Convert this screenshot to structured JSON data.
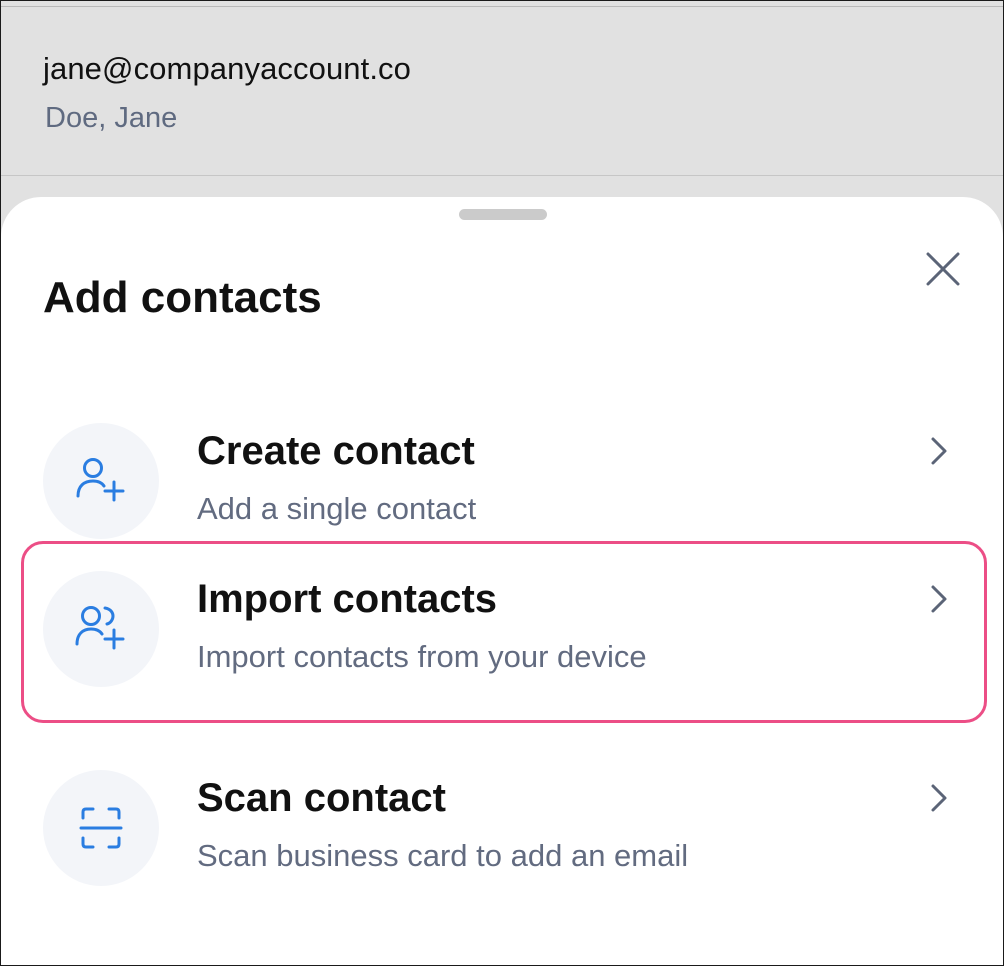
{
  "account": {
    "email": "jane@companyaccount.co",
    "name": "Doe, Jane"
  },
  "sheet": {
    "title": "Add contacts",
    "close_icon": "close-icon",
    "options": [
      {
        "title": "Create contact",
        "subtitle": "Add a single contact",
        "icon": "person-add-icon",
        "highlighted": false
      },
      {
        "title": "Import contacts",
        "subtitle": "Import contacts from your device",
        "icon": "people-add-icon",
        "highlighted": true
      },
      {
        "title": "Scan contact",
        "subtitle": "Scan business card to add an email",
        "icon": "scan-icon",
        "highlighted": false
      }
    ]
  },
  "colors": {
    "accent_blue": "#2a7de1",
    "highlight_pink": "#ec4e86",
    "background_gray": "#e1e1e1",
    "icon_circle": "#f3f5f9",
    "subtitle_gray": "#626b80"
  }
}
